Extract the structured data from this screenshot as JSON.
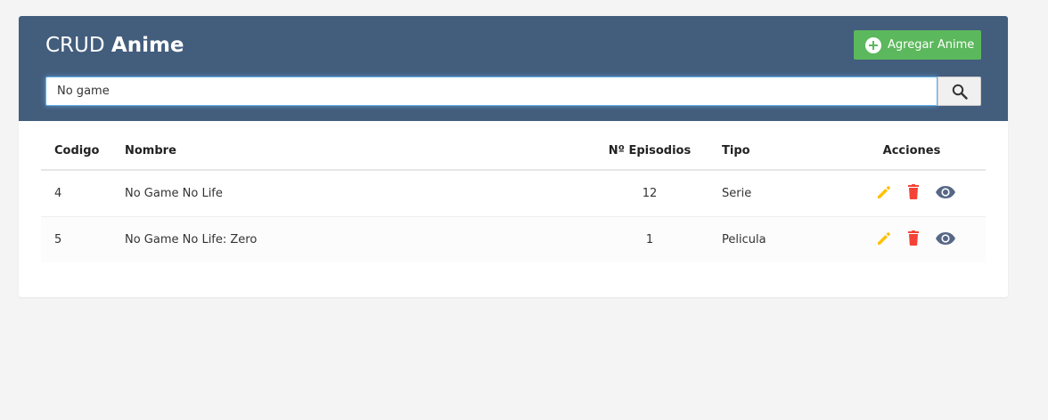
{
  "header": {
    "title_light": "CRUD",
    "title_bold": "Anime",
    "add_button_label": "Agregar Anime"
  },
  "search": {
    "value": "No game",
    "placeholder": ""
  },
  "table": {
    "columns": [
      "Codigo",
      "Nombre",
      "Nº Episodios",
      "Tipo",
      "Acciones"
    ],
    "rows": [
      {
        "codigo": "4",
        "nombre": "No Game No Life",
        "episodios": "12",
        "tipo": "Serie"
      },
      {
        "codigo": "5",
        "nombre": "No Game No Life: Zero",
        "episodios": "1",
        "tipo": "Pelicula"
      }
    ]
  },
  "icons": {
    "add": "plus-circle-icon",
    "search": "search-icon",
    "edit": "pencil-icon",
    "delete": "trash-icon",
    "view": "eye-icon"
  },
  "colors": {
    "header_bg": "#435d7d",
    "add_button": "#5cb85c",
    "edit_icon": "#ffc107",
    "delete_icon": "#f44336",
    "view_icon": "#566787"
  }
}
